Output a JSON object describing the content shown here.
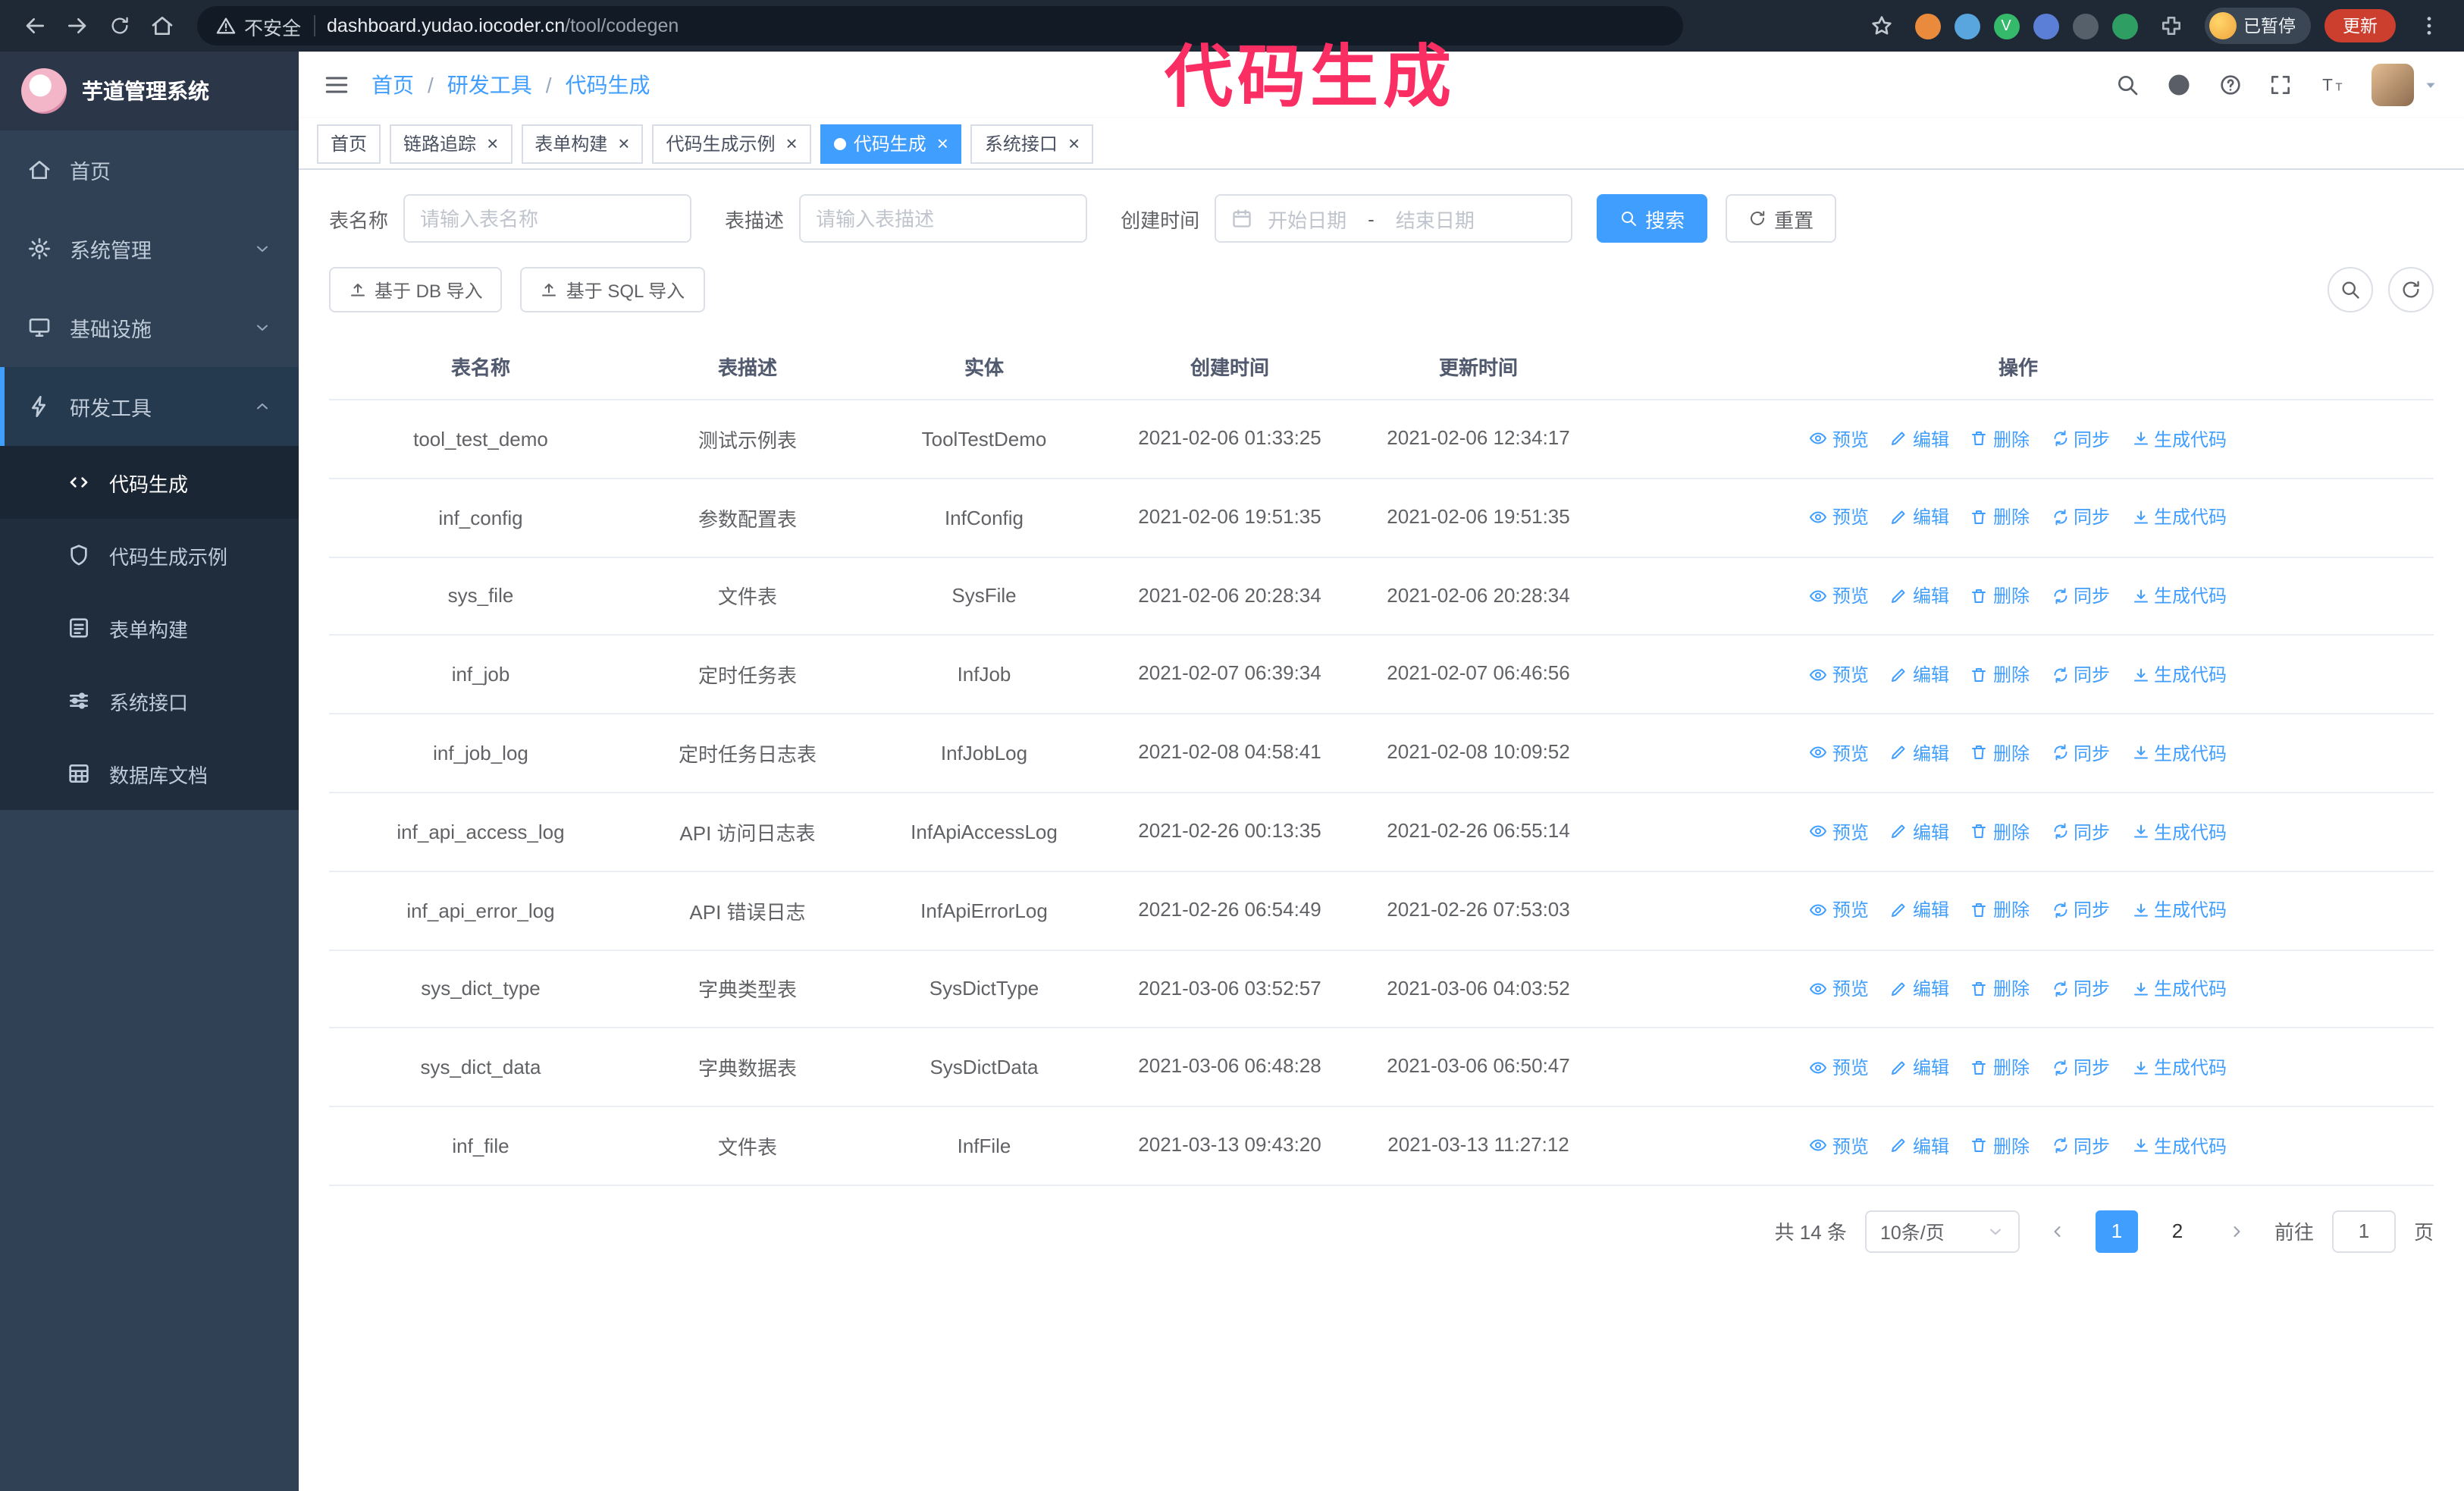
{
  "browser": {
    "security_label": "不安全",
    "url_host": "dashboard.yudao.iocoder.cn",
    "url_path": "/tool/codegen",
    "paused_badge": "已暂停",
    "update_button": "更新"
  },
  "annotation": {
    "text": "代码生成"
  },
  "sidebar": {
    "app_title": "芋道管理系统",
    "items": [
      {
        "label": "首页"
      },
      {
        "label": "系统管理"
      },
      {
        "label": "基础设施"
      },
      {
        "label": "研发工具"
      }
    ],
    "submenu": [
      "代码生成",
      "代码生成示例",
      "表单构建",
      "系统接口",
      "数据库文档"
    ]
  },
  "breadcrumb": [
    "首页",
    "研发工具",
    "代码生成"
  ],
  "tabs": [
    {
      "label": "首页",
      "active": false,
      "closable": false
    },
    {
      "label": "链路追踪",
      "active": false,
      "closable": true
    },
    {
      "label": "表单构建",
      "active": false,
      "closable": true
    },
    {
      "label": "代码生成示例",
      "active": false,
      "closable": true
    },
    {
      "label": "代码生成",
      "active": true,
      "closable": true
    },
    {
      "label": "系统接口",
      "active": false,
      "closable": true
    }
  ],
  "filters": {
    "table_name_label": "表名称",
    "table_name_placeholder": "请输入表名称",
    "table_desc_label": "表描述",
    "table_desc_placeholder": "请输入表描述",
    "create_time_label": "创建时间",
    "date_start_placeholder": "开始日期",
    "date_separator": "-",
    "date_end_placeholder": "结束日期",
    "search_button": "搜索",
    "reset_button": "重置"
  },
  "toolbar": {
    "import_db_button": "基于 DB 导入",
    "import_sql_button": "基于 SQL 导入"
  },
  "table": {
    "columns": [
      "表名称",
      "表描述",
      "实体",
      "创建时间",
      "更新时间",
      "操作"
    ],
    "actions": [
      {
        "key": "preview",
        "label": "预览",
        "icon": "eye"
      },
      {
        "key": "edit",
        "label": "编辑",
        "icon": "edit"
      },
      {
        "key": "delete",
        "label": "删除",
        "icon": "trash"
      },
      {
        "key": "sync",
        "label": "同步",
        "icon": "sync"
      },
      {
        "key": "generate",
        "label": "生成代码",
        "icon": "download"
      }
    ],
    "rows": [
      {
        "name": "tool_test_demo",
        "desc": "测试示例表",
        "entity": "ToolTestDemo",
        "created": "2021-02-06 01:33:25",
        "updated": "2021-02-06 12:34:17"
      },
      {
        "name": "inf_config",
        "desc": "参数配置表",
        "entity": "InfConfig",
        "created": "2021-02-06 19:51:35",
        "updated": "2021-02-06 19:51:35"
      },
      {
        "name": "sys_file",
        "desc": "文件表",
        "entity": "SysFile",
        "created": "2021-02-06 20:28:34",
        "updated": "2021-02-06 20:28:34"
      },
      {
        "name": "inf_job",
        "desc": "定时任务表",
        "entity": "InfJob",
        "created": "2021-02-07 06:39:34",
        "updated": "2021-02-07 06:46:56"
      },
      {
        "name": "inf_job_log",
        "desc": "定时任务日志表",
        "entity": "InfJobLog",
        "created": "2021-02-08 04:58:41",
        "updated": "2021-02-08 10:09:52"
      },
      {
        "name": "inf_api_access_log",
        "desc": "API 访问日志表",
        "entity": "InfApiAccessLog",
        "created": "2021-02-26 00:13:35",
        "updated": "2021-02-26 06:55:14"
      },
      {
        "name": "inf_api_error_log",
        "desc": "API 错误日志",
        "entity": "InfApiErrorLog",
        "created": "2021-02-26 06:54:49",
        "updated": "2021-02-26 07:53:03"
      },
      {
        "name": "sys_dict_type",
        "desc": "字典类型表",
        "entity": "SysDictType",
        "created": "2021-03-06 03:52:57",
        "updated": "2021-03-06 04:03:52"
      },
      {
        "name": "sys_dict_data",
        "desc": "字典数据表",
        "entity": "SysDictData",
        "created": "2021-03-06 06:48:28",
        "updated": "2021-03-06 06:50:47"
      },
      {
        "name": "inf_file",
        "desc": "文件表",
        "entity": "InfFile",
        "created": "2021-03-13 09:43:20",
        "updated": "2021-03-13 11:27:12"
      }
    ]
  },
  "pagination": {
    "total": "共 14 条",
    "page_size": "10条/页",
    "pages": [
      "1",
      "2"
    ],
    "active_page": "1",
    "goto_prefix": "前往",
    "goto_value": "1",
    "goto_suffix": "页"
  }
}
